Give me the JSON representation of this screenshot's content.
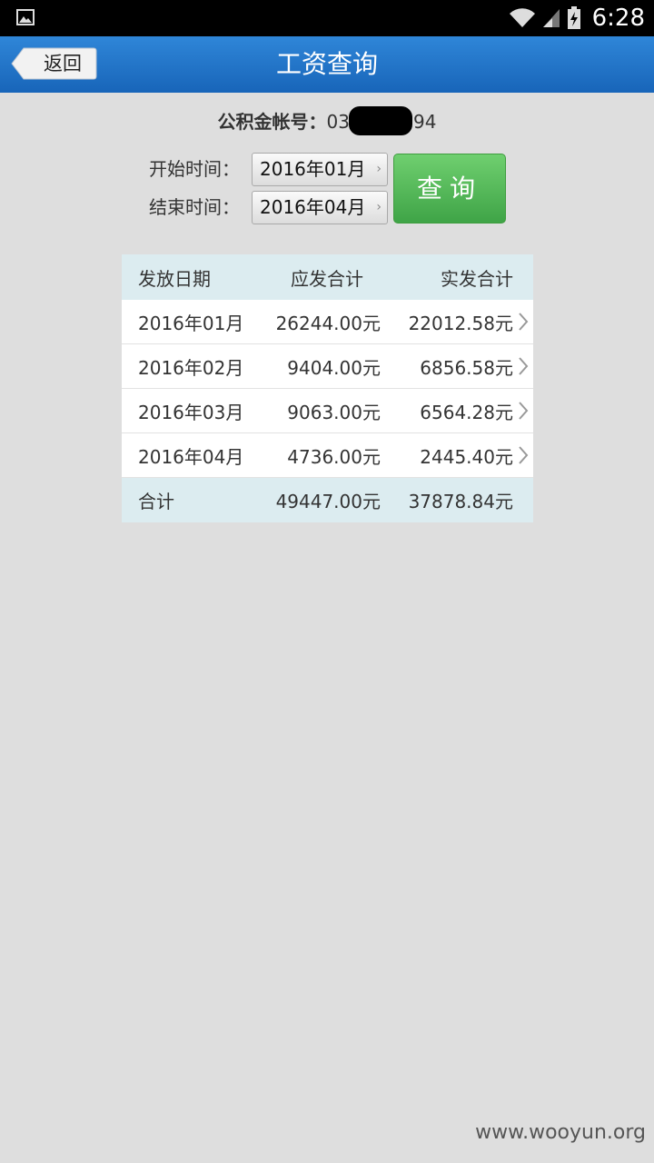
{
  "status_bar": {
    "time": "6:28",
    "icons": [
      "image-icon",
      "wifi-icon",
      "signal-icon",
      "battery-charging-icon"
    ]
  },
  "header": {
    "back_label": "返回",
    "title": "工资查询"
  },
  "account": {
    "label": "公积金帐号：",
    "value_prefix": "03",
    "value_suffix": "94"
  },
  "query_form": {
    "start_label": "开始时间：",
    "start_value": "2016年01月",
    "end_label": "结束时间：",
    "end_value": "2016年04月",
    "query_label": "查询"
  },
  "table": {
    "columns": [
      "发放日期",
      "应发合计",
      "实发合计"
    ],
    "rows": [
      {
        "date": "2016年01月",
        "gross": "26244.00元",
        "net": "22012.58元"
      },
      {
        "date": "2016年02月",
        "gross": "9404.00元",
        "net": "6856.58元"
      },
      {
        "date": "2016年03月",
        "gross": "9063.00元",
        "net": "6564.28元"
      },
      {
        "date": "2016年04月",
        "gross": "4736.00元",
        "net": "2445.40元"
      }
    ],
    "total": {
      "label": "合计",
      "gross": "49447.00元",
      "net": "37878.84元"
    }
  },
  "watermark": "www.wooyun.org",
  "colors": {
    "header_blue": "#1f74c8",
    "query_green": "#4cb052",
    "table_header": "#dcecf0",
    "background": "#dedede"
  }
}
